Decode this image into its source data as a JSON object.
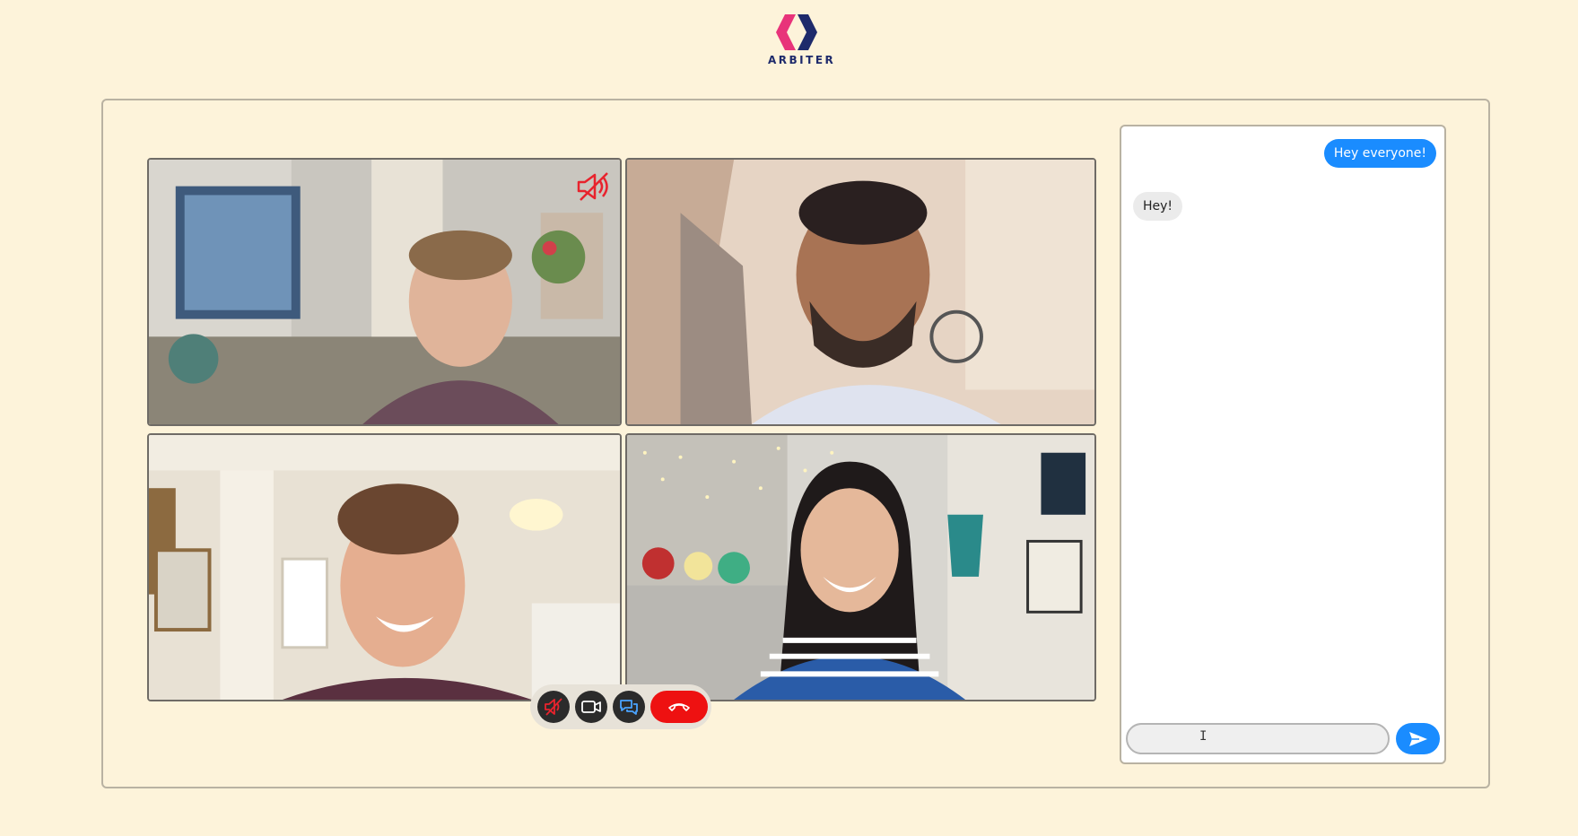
{
  "brand": {
    "name": "ARBITER"
  },
  "colors": {
    "accent_blue": "#1a8cff",
    "end_call_red": "#ee1111",
    "mute_red": "#e8232d",
    "logo_pink": "#e8337a",
    "logo_navy": "#1e2a6b"
  },
  "video_tiles": [
    {
      "participant": "participant-1",
      "muted": true,
      "mute_icon": "speaker-muted-icon"
    },
    {
      "participant": "participant-2",
      "muted": false
    },
    {
      "participant": "participant-3",
      "muted": false
    },
    {
      "participant": "participant-4",
      "muted": false
    }
  ],
  "controls": {
    "mute_icon": "microphone-muted-icon",
    "camera_icon": "video-camera-icon",
    "chat_icon": "chat-bubbles-icon",
    "end_call_icon": "phone-hangup-icon"
  },
  "chat": {
    "messages": [
      {
        "direction": "sent",
        "text": "Hey everyone!"
      },
      {
        "direction": "received",
        "text": "Hey!"
      }
    ],
    "input": {
      "value": "",
      "placeholder": ""
    },
    "send_icon": "send-arrow-icon"
  }
}
